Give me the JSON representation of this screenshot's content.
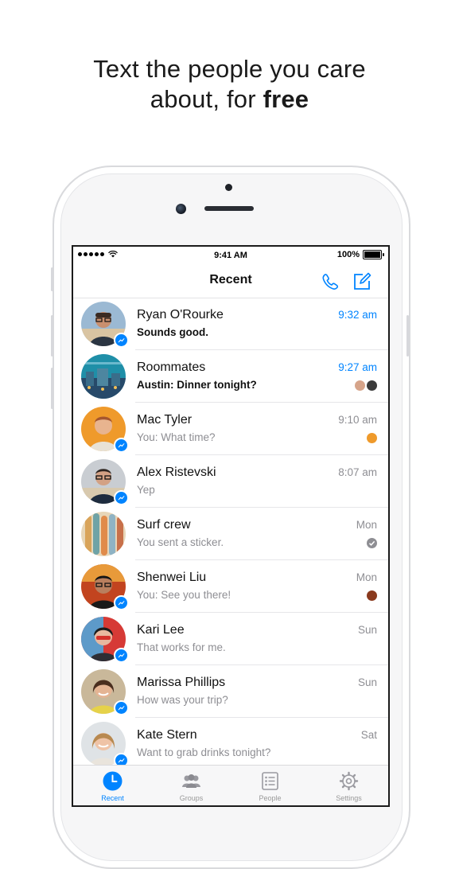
{
  "headline": {
    "line1": "Text the people you care",
    "line2_prefix": "about, for ",
    "line2_bold": "free"
  },
  "status_bar": {
    "time": "9:41 AM",
    "battery": "100%"
  },
  "nav": {
    "title": "Recent",
    "call_icon": "phone-icon",
    "compose_icon": "compose-icon"
  },
  "colors": {
    "accent": "#0084ff",
    "secondary_text": "#8e8e93"
  },
  "conversations": [
    {
      "name": "Ryan O'Rourke",
      "message": "Sounds good.",
      "time": "9:32 am",
      "unread": true
    },
    {
      "name": "Roommates",
      "message": "Austin: Dinner tonight?",
      "time": "9:27 am",
      "unread": true
    },
    {
      "name": "Mac Tyler",
      "message": "You: What time?",
      "time": "9:10 am",
      "unread": false
    },
    {
      "name": "Alex Ristevski",
      "message": "Yep",
      "time": "8:07 am",
      "unread": false
    },
    {
      "name": "Surf crew",
      "message": "You sent a sticker.",
      "time": "Mon",
      "unread": false
    },
    {
      "name": "Shenwei Liu",
      "message": "You: See you there!",
      "time": "Mon",
      "unread": false
    },
    {
      "name": "Kari Lee",
      "message": "That works for me.",
      "time": "Sun",
      "unread": false
    },
    {
      "name": "Marissa Phillips",
      "message": "How was your trip?",
      "time": "Sun",
      "unread": false
    },
    {
      "name": "Kate Stern",
      "message": "Want to grab drinks tonight?",
      "time": "Sat",
      "unread": false
    }
  ],
  "tabs": [
    {
      "label": "Recent",
      "icon": "clock-icon",
      "active": true
    },
    {
      "label": "Groups",
      "icon": "groups-icon",
      "active": false
    },
    {
      "label": "People",
      "icon": "people-list-icon",
      "active": false
    },
    {
      "label": "Settings",
      "icon": "gear-icon",
      "active": false
    }
  ]
}
